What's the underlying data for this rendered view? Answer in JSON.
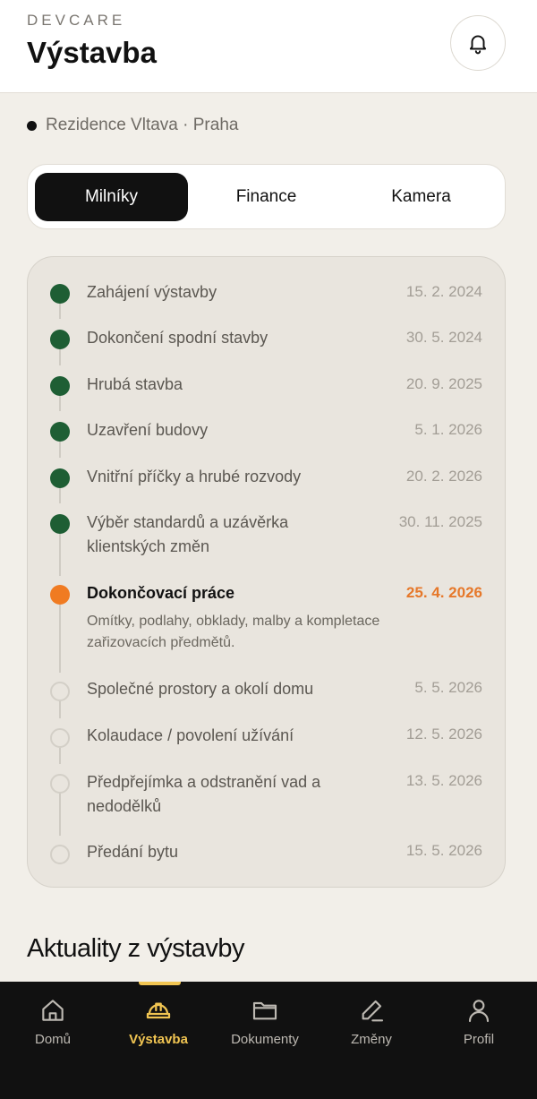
{
  "header": {
    "brand": "DEVCARE",
    "title": "Výstavba",
    "notifications_icon": "bell-icon"
  },
  "project": {
    "label": "Rezidence Vltava · Praha"
  },
  "tabs": [
    {
      "label": "Milníky",
      "active": true
    },
    {
      "label": "Finance",
      "active": false
    },
    {
      "label": "Kamera",
      "active": false
    }
  ],
  "milestones": [
    {
      "title": "Zahájení výstavby",
      "date": "15. 2. 2024",
      "status": "done"
    },
    {
      "title": "Dokončení spodní stavby",
      "date": "30. 5. 2024",
      "status": "done"
    },
    {
      "title": "Hrubá stavba",
      "date": "20. 9. 2025",
      "status": "done"
    },
    {
      "title": "Uzavření budovy",
      "date": "5. 1. 2026",
      "status": "done"
    },
    {
      "title": "Vnitřní příčky a hrubé rozvody",
      "date": "20. 2. 2026",
      "status": "done"
    },
    {
      "title": "Výběr standardů a uzávěrka klientských změn",
      "date": "30. 11. 2025",
      "status": "done"
    },
    {
      "title": "Dokončovací práce",
      "date": "25. 4. 2026",
      "status": "current",
      "description": "Omítky, podlahy, obklady, malby a kompletace zařizovacích předmětů."
    },
    {
      "title": "Společné prostory a okolí domu",
      "date": "5. 5. 2026",
      "status": "pending"
    },
    {
      "title": "Kolaudace / povolení užívání",
      "date": "12. 5. 2026",
      "status": "pending"
    },
    {
      "title": "Předpřejímka a odstranění vad a nedodělků",
      "date": "13. 5. 2026",
      "status": "pending"
    },
    {
      "title": "Předání bytu",
      "date": "15. 5. 2026",
      "status": "pending"
    }
  ],
  "news": {
    "title": "Aktuality z výstavby"
  },
  "nav": [
    {
      "label": "Domů",
      "icon": "home-icon",
      "active": false
    },
    {
      "label": "Výstavba",
      "icon": "helmet-icon",
      "active": true
    },
    {
      "label": "Dokumenty",
      "icon": "folder-icon",
      "active": false
    },
    {
      "label": "Změny",
      "icon": "pencil-icon",
      "active": false
    },
    {
      "label": "Profil",
      "icon": "user-icon",
      "active": false
    }
  ],
  "colors": {
    "done": "#1e5e34",
    "current": "#f07b22",
    "accent": "#f1c552",
    "background": "#f2efe9"
  }
}
